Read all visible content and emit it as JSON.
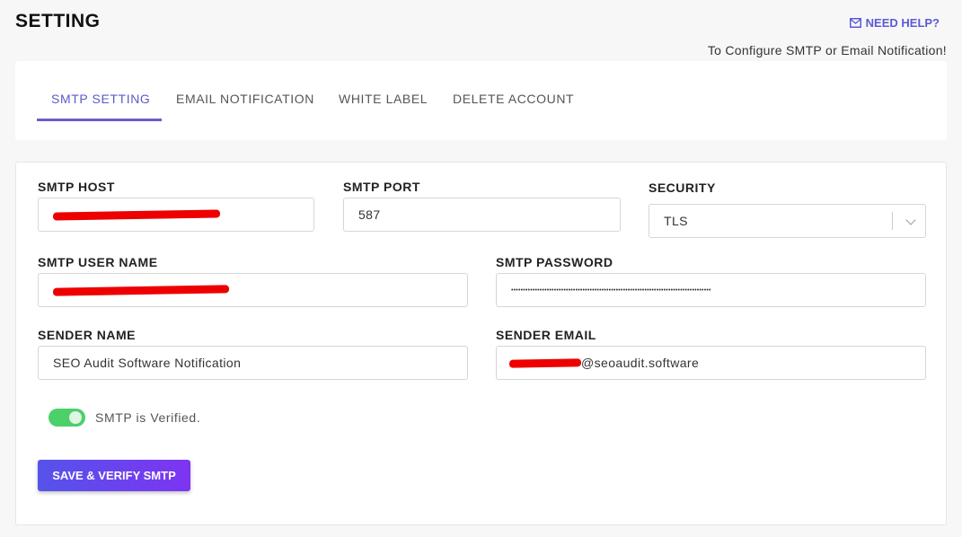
{
  "header": {
    "title": "SETTING",
    "help_label": "NEED HELP?",
    "help_icon": "envelope-icon",
    "subtitle": "To Configure SMTP or Email Notification!",
    "accent": "#5b5bd6"
  },
  "tabs": [
    {
      "label": "SMTP SETTING",
      "active": true
    },
    {
      "label": "EMAIL NOTIFICATION",
      "active": false
    },
    {
      "label": "WHITE LABEL",
      "active": false
    },
    {
      "label": "DELETE ACCOUNT",
      "active": false
    }
  ],
  "form": {
    "smtp_host": {
      "label": "SMTP HOST",
      "value": "",
      "redacted": true
    },
    "smtp_port": {
      "label": "SMTP PORT",
      "value": "587"
    },
    "security": {
      "label": "SECURITY",
      "value": "TLS"
    },
    "smtp_user": {
      "label": "SMTP USER NAME",
      "value": "",
      "redacted": true
    },
    "smtp_password": {
      "label": "SMTP PASSWORD",
      "value": "••••••••••••••••••••••••••••••••••••••••••••••••••••••••••••••••••••••••••••••••••••"
    },
    "sender_name": {
      "label": "SENDER NAME",
      "value": "SEO Audit Software Notification"
    },
    "sender_email": {
      "label": "SENDER EMAIL",
      "value": "@seoaudit.software",
      "redacted_prefix": true
    }
  },
  "verified": {
    "label": "SMTP is Verified.",
    "on": true,
    "color": "#4cd06a"
  },
  "save_button": "SAVE & VERIFY SMTP"
}
